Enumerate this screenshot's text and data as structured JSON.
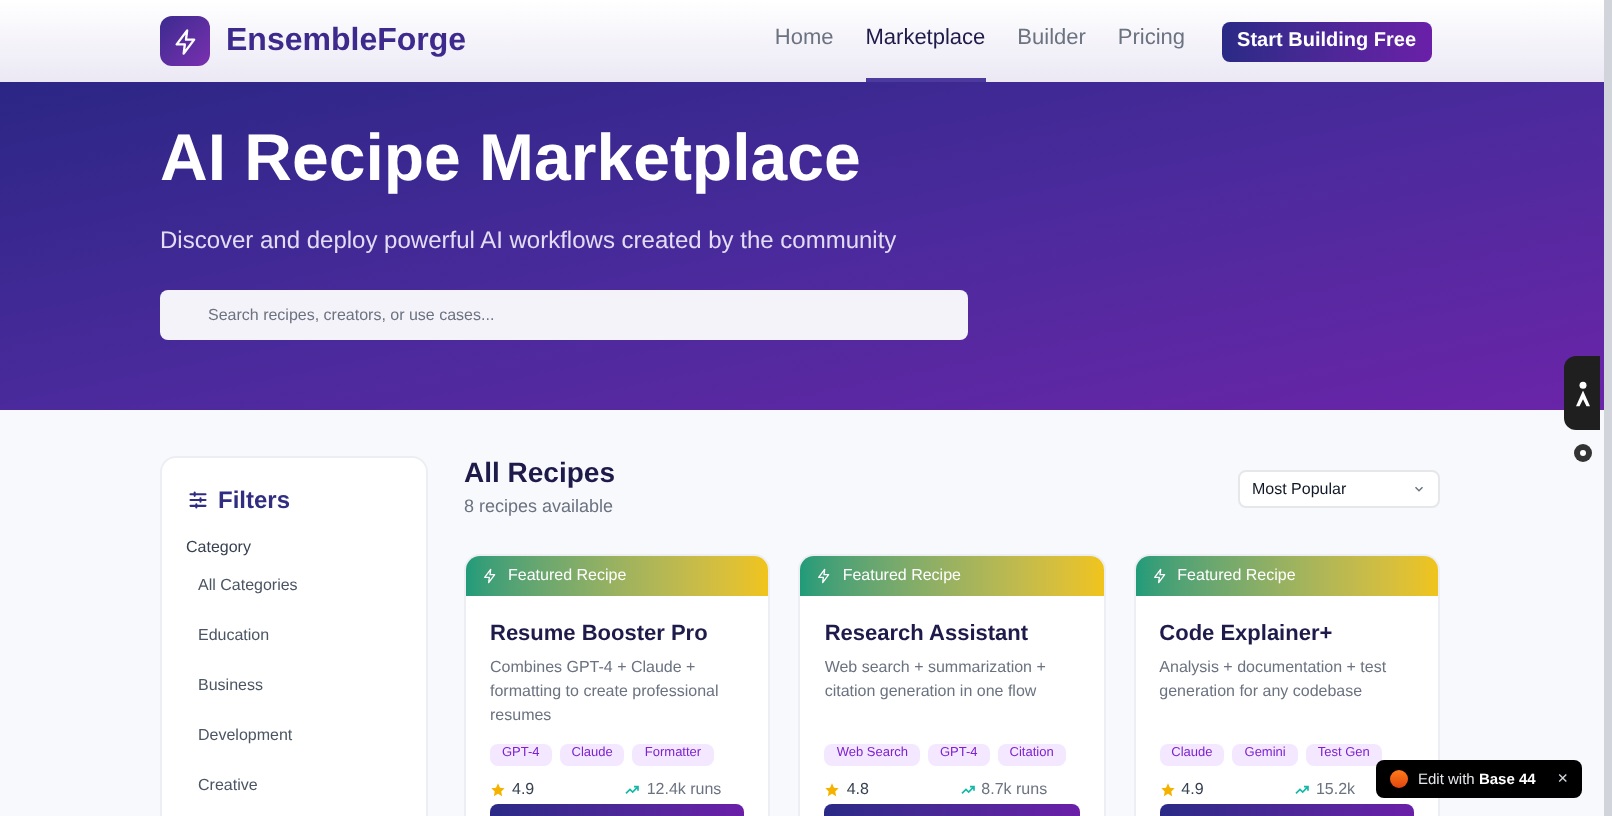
{
  "brand": "EnsembleForge",
  "nav": [
    {
      "label": "Home",
      "selected": false
    },
    {
      "label": "Marketplace",
      "selected": true
    },
    {
      "label": "Builder",
      "selected": false
    },
    {
      "label": "Pricing",
      "selected": false
    }
  ],
  "cta": "Start Building Free",
  "hero": {
    "title": "AI Recipe Marketplace",
    "subtitle": "Discover and deploy powerful AI workflows created by the community",
    "search": {
      "placeholder": "Search recipes, creators, or use cases..."
    }
  },
  "filters": {
    "title": "Filters",
    "section": "Category",
    "categories": [
      "All Categories",
      "Education",
      "Business",
      "Development",
      "Creative"
    ]
  },
  "list": {
    "title": "All Recipes",
    "count": "8 recipes available",
    "sort": "Most Popular"
  },
  "recipes": [
    {
      "badge": "Featured Recipe",
      "title": "Resume Booster Pro",
      "description": "Combines GPT-4 + Claude + formatting to create professional resumes",
      "tags": [
        "GPT-4",
        "Claude",
        "Formatter"
      ],
      "rating": "4.9",
      "runs": "12.4k runs"
    },
    {
      "badge": "Featured Recipe",
      "title": "Research Assistant",
      "description": "Web search + summarization + citation generation in one flow",
      "tags": [
        "Web Search",
        "GPT-4",
        "Citation"
      ],
      "rating": "4.8",
      "runs": "8.7k runs"
    },
    {
      "badge": "Featured Recipe",
      "title": "Code Explainer+",
      "description": "Analysis + documentation + test generation for any codebase",
      "tags": [
        "Claude",
        "Gemini",
        "Test Gen"
      ],
      "rating": "4.9",
      "runs": "15.2k"
    }
  ],
  "edit_badge": {
    "prefix": "Edit with",
    "brand": "Base 44",
    "close": "×"
  }
}
